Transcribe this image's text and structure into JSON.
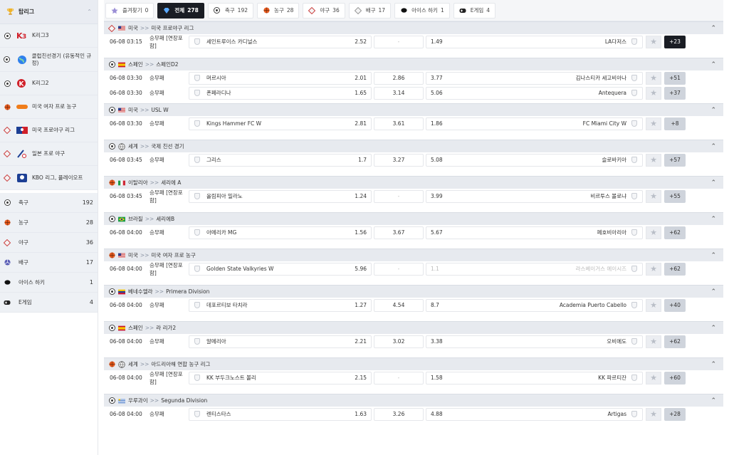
{
  "sidebar": {
    "header_title": "탑리그",
    "leagues": [
      {
        "label": "K리그3",
        "sport": "soccer"
      },
      {
        "label": "클럽친선경기 (유동적인 규정)",
        "sport": "soccer"
      },
      {
        "label": "K리그2",
        "sport": "soccer"
      },
      {
        "label": "미국 여자 프로 농구",
        "sport": "basketball"
      },
      {
        "label": "미국 프로야구 리그",
        "sport": "baseball"
      },
      {
        "label": "일본 프로 야구",
        "sport": "baseball"
      },
      {
        "label": "KBO 리그, 플레이오프",
        "sport": "baseball"
      }
    ],
    "sports": [
      {
        "label": "축구",
        "count": "192"
      },
      {
        "label": "농구",
        "count": "28"
      },
      {
        "label": "야구",
        "count": "36"
      },
      {
        "label": "배구",
        "count": "17"
      },
      {
        "label": "아이스 하키",
        "count": "1"
      },
      {
        "label": "E게임",
        "count": "4"
      }
    ]
  },
  "tabs": [
    {
      "label": "즐겨찾기",
      "count": "0"
    },
    {
      "label": "전체",
      "count": "278"
    },
    {
      "label": "축구",
      "count": "192"
    },
    {
      "label": "농구",
      "count": "28"
    },
    {
      "label": "야구",
      "count": "36"
    },
    {
      "label": "배구",
      "count": "17"
    },
    {
      "label": "아이스 하키",
      "count": "1"
    },
    {
      "label": "E게임",
      "count": "4"
    }
  ],
  "groups": [
    {
      "country": "미국",
      "league": "미국 프로야구 리그",
      "sport": "baseball",
      "flag": "us",
      "match": {
        "time": "06-08 03:15",
        "market": "승무패 [연장포함]",
        "home": "세인트루이스 카디널스",
        "home_odds": "2.52",
        "draw": "-",
        "away_odds": "1.49",
        "away": "LA다저스",
        "more": "+23",
        "more_dark": true
      }
    },
    {
      "country": "스페인",
      "league": "스페인D2",
      "sport": "soccer",
      "flag": "es",
      "match": {
        "time": "06-08 03:30",
        "market": "승무패",
        "home": "머르시아",
        "home_odds": "2.01",
        "draw": "2.86",
        "away_odds": "3.77",
        "away": "김나스티카 세고비아나",
        "more": "+51"
      },
      "match2": {
        "time": "06-08 03:30",
        "market": "승무패",
        "home": "폰페라디나",
        "home_odds": "1.65",
        "draw": "3.14",
        "away_odds": "5.06",
        "away": "Antequera",
        "more": "+37"
      }
    },
    {
      "country": "미국",
      "league": "USL W",
      "sport": "soccer",
      "flag": "us",
      "match": {
        "time": "06-08 03:30",
        "market": "승무패",
        "home": "Kings Hammer FC W",
        "home_odds": "2.81",
        "draw": "3.61",
        "away_odds": "1.86",
        "away": "FC Miami City W",
        "more": "+8"
      }
    },
    {
      "country": "세계",
      "league": "국제 친선 경기",
      "sport": "soccer",
      "flag": "world",
      "match": {
        "time": "06-08 03:45",
        "market": "승무패",
        "home": "그리스",
        "home_odds": "1.7",
        "draw": "3.27",
        "away_odds": "5.08",
        "away": "슬로바키아",
        "more": "+57"
      }
    },
    {
      "country": "이탈리아",
      "league": "세리에 A",
      "sport": "basketball",
      "flag": "it",
      "match": {
        "time": "06-08 03:45",
        "market": "승무패 [연장포함]",
        "home": "올림피아 밀라노",
        "home_odds": "1.24",
        "draw": "-",
        "away_odds": "3.99",
        "away": "비르투스 볼로냐",
        "more": "+55"
      }
    },
    {
      "country": "브라질",
      "league": "세리에B",
      "sport": "soccer",
      "flag": "br",
      "match": {
        "time": "06-08 04:00",
        "market": "승무패",
        "home": "아메리카 MG",
        "home_odds": "1.56",
        "draw": "3.67",
        "away_odds": "5.67",
        "away": "페호비아리아",
        "more": "+62"
      }
    },
    {
      "country": "미국",
      "league": "미국 여자 프로 농구",
      "sport": "basketball",
      "flag": "us",
      "match": {
        "time": "06-08 04:00",
        "market": "승무패 [연장포함]",
        "home": "Golden State Valkyries W",
        "home_odds": "5.96",
        "draw": "-",
        "away_odds": "1.1",
        "away": "라스베이거스 에이시즈",
        "more": "+62",
        "away_disabled": true
      }
    },
    {
      "country": "베네수엘라",
      "league": "Primera Division",
      "sport": "soccer",
      "flag": "ve",
      "match": {
        "time": "06-08 04:00",
        "market": "승무패",
        "home": "데포르티보 타치라",
        "home_odds": "1.27",
        "draw": "4.54",
        "away_odds": "8.7",
        "away": "Academia Puerto Cabello",
        "more": "+40"
      }
    },
    {
      "country": "스페인",
      "league": "라 리가2",
      "sport": "soccer",
      "flag": "es",
      "match": {
        "time": "06-08 04:00",
        "market": "승무패",
        "home": "알메리아",
        "home_odds": "2.21",
        "draw": "3.02",
        "away_odds": "3.38",
        "away": "오비에도",
        "more": "+62"
      }
    },
    {
      "country": "세계",
      "league": "아드리아해 연합 농구 리그",
      "sport": "basketball",
      "flag": "world",
      "match": {
        "time": "06-08 04:00",
        "market": "승무패 [연장포함]",
        "home": "KK 부두크노스트 볼리",
        "home_odds": "2.15",
        "draw": "-",
        "away_odds": "1.58",
        "away": "KK 파르티잔",
        "more": "+60"
      }
    },
    {
      "country": "우루과이",
      "league": "Segunda Division",
      "sport": "soccer",
      "flag": "uy",
      "match": {
        "time": "06-08 04:00",
        "market": "승무패",
        "home": "렌티스타스",
        "home_odds": "1.63",
        "draw": "3.26",
        "away_odds": "4.88",
        "away": "Artigas",
        "more": "+28"
      }
    }
  ],
  "colors": {
    "accent_dark": "#1a1d24",
    "group_bg": "#e7eaef",
    "sidebar_bg": "#eef1f5"
  }
}
